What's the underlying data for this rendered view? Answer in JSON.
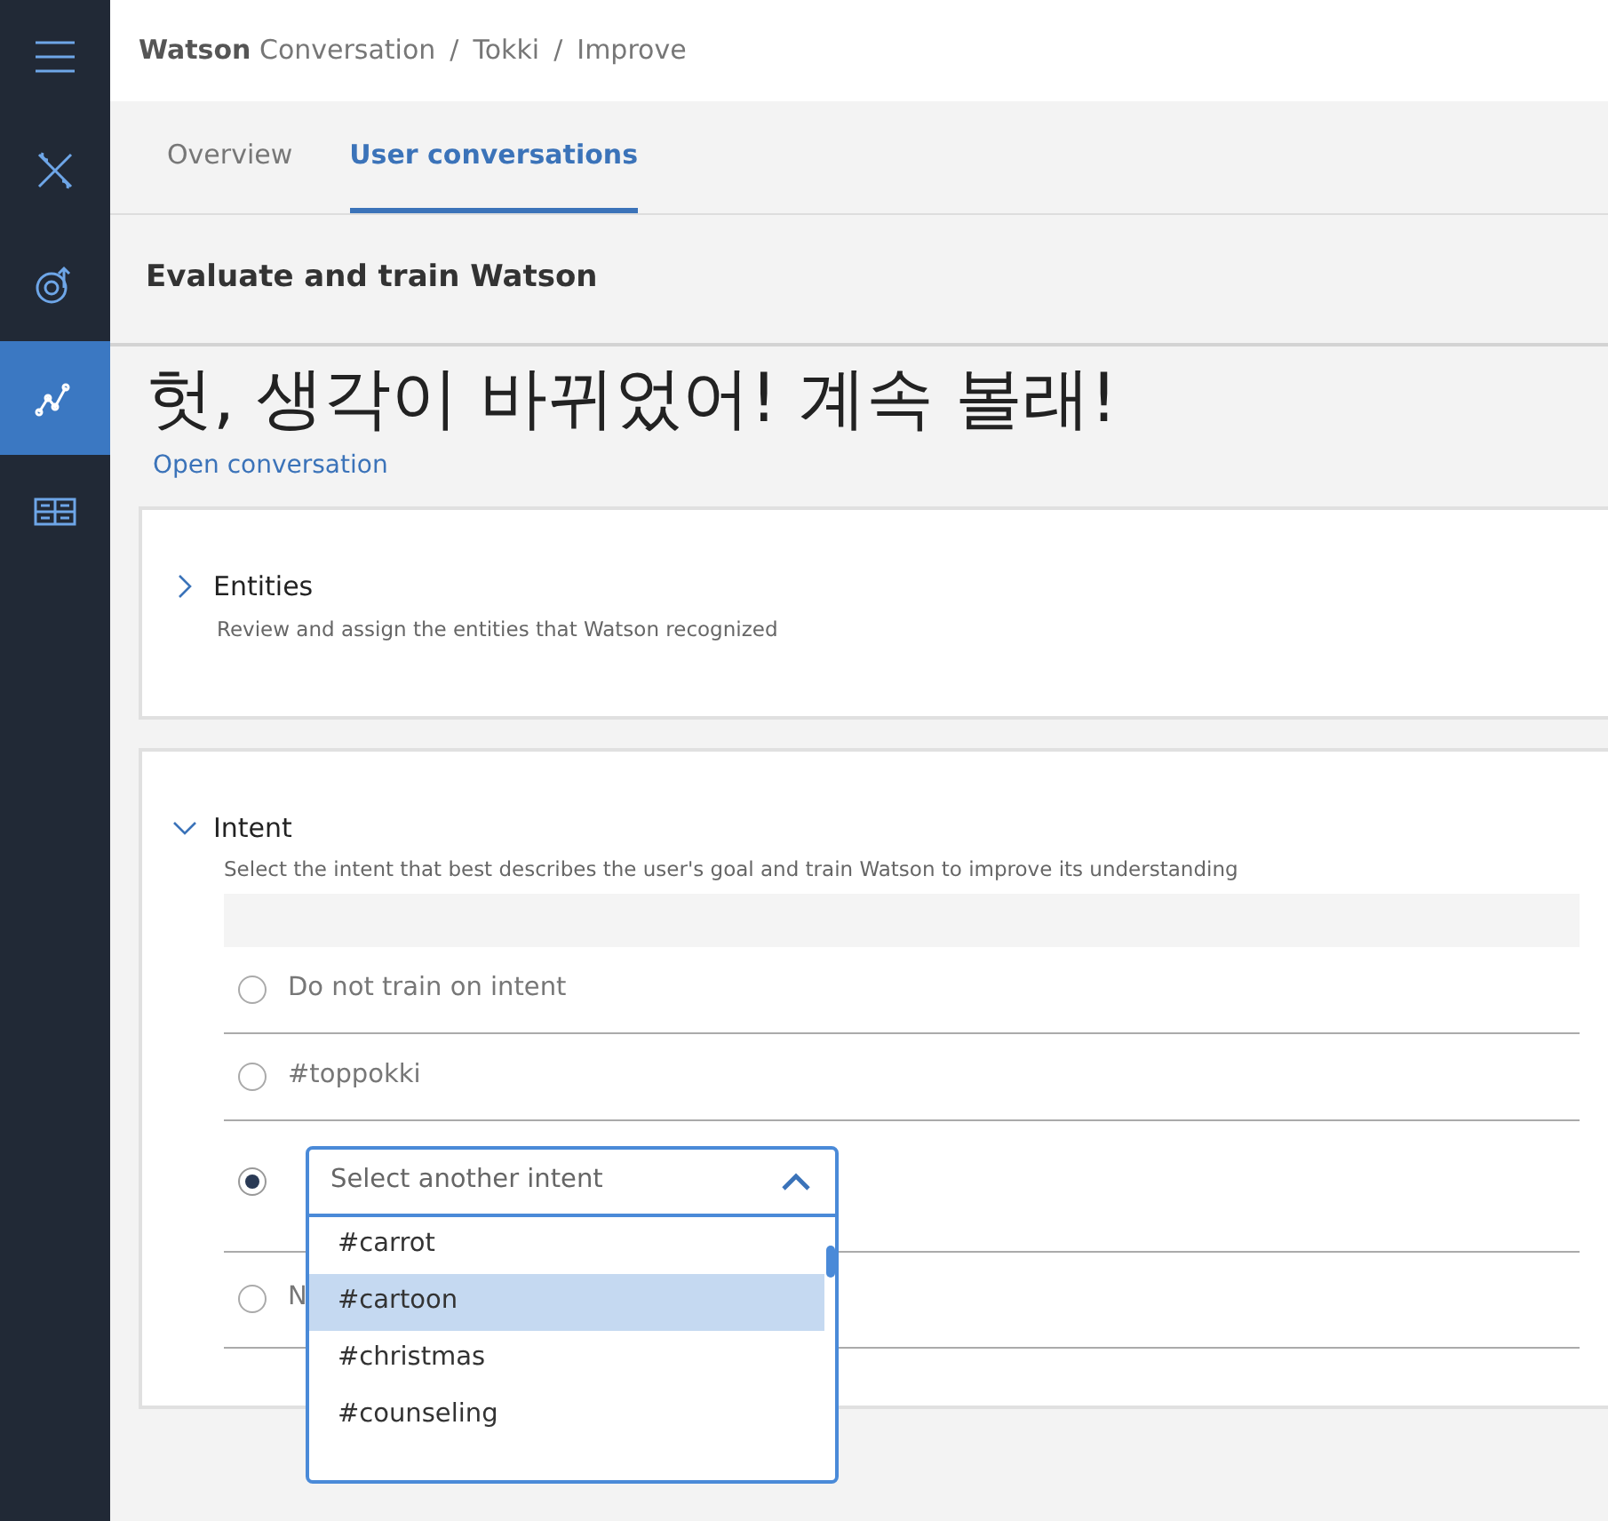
{
  "sidebar": {
    "items": [
      {
        "kind": "menu",
        "selected": false
      },
      {
        "kind": "tools",
        "selected": false
      },
      {
        "kind": "target",
        "selected": false
      },
      {
        "kind": "chart",
        "selected": true
      },
      {
        "kind": "grid",
        "selected": false
      }
    ]
  },
  "breadcrumb": [
    "**Watson** Conversation",
    "Tokki",
    "Improve"
  ],
  "breadcrumb_separator": "/",
  "tabs": [
    {
      "label": "Overview",
      "selected": false
    },
    {
      "label": "User conversations",
      "selected": true
    }
  ],
  "section_title": "Evaluate and train Watson",
  "message": "헛, 생각이 바뀌었어! 계속 볼래!",
  "open_link": "Open conversation",
  "panels": [
    {
      "title": "Entities",
      "description": "Review and assign the entities that Watson recognized",
      "expanded": false
    },
    {
      "title": "Intent",
      "description": "Select the intent that best describes the user's goal and train Watson to improve its understanding",
      "expanded": true,
      "options": [
        {
          "kind": "option",
          "label": "Do not train on intent",
          "selected": false
        },
        {
          "kind": "option",
          "label": "#toppokki",
          "selected": false
        },
        {
          "kind": "select",
          "selected": true
        },
        {
          "kind": "option",
          "label": "N",
          "selected": false
        }
      ],
      "dropdown": {
        "placeholder": "Select another intent",
        "expanded": true,
        "choices": [
          {
            "label": "#carrot",
            "selected": false
          },
          {
            "label": "#cartoon",
            "selected": true
          },
          {
            "label": "#christmas",
            "selected": false
          },
          {
            "label": "#counseling",
            "selected": false
          }
        ]
      }
    }
  ]
}
